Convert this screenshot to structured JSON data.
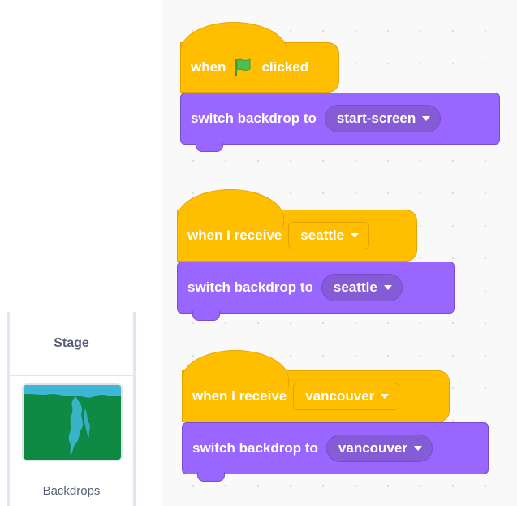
{
  "stage_panel": {
    "title": "Stage",
    "backdrops_label": "Backdrops"
  },
  "scripts": [
    {
      "hat": {
        "prefix": "when",
        "icon": "green-flag-icon",
        "suffix": "clicked"
      },
      "stack": {
        "label": "switch backdrop to",
        "dropdown": "start-screen"
      }
    },
    {
      "hat": {
        "label": "when I receive",
        "dropdown": "seattle"
      },
      "stack": {
        "label": "switch backdrop to",
        "dropdown": "seattle"
      }
    },
    {
      "hat": {
        "label": "when I receive",
        "dropdown": "vancouver"
      },
      "stack": {
        "label": "switch backdrop to",
        "dropdown": "vancouver"
      }
    }
  ],
  "colors": {
    "events_block": "#ffbf00",
    "looks_block": "#9966ff",
    "flag": "#4cbf56",
    "backdrop_thumb": "#0f8a45"
  }
}
